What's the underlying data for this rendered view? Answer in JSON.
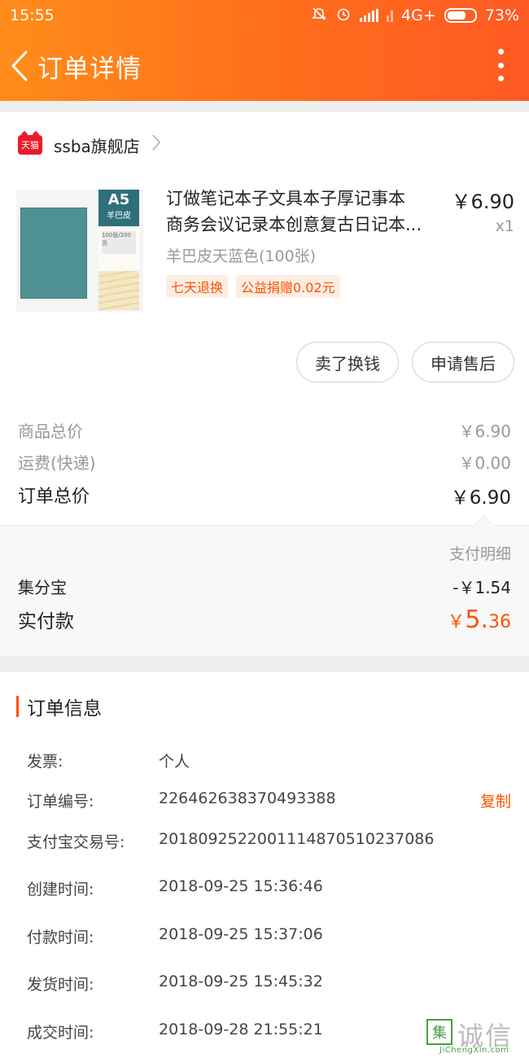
{
  "status_bar": {
    "time": "15:55",
    "network": "4G+",
    "battery": "73%",
    "battery_level": 0.73,
    "icons": [
      "mute-icon",
      "alarm-icon",
      "signal-icon",
      "signal-icon",
      "battery-icon"
    ]
  },
  "navbar": {
    "title": "订单详情",
    "back_icon": "chevron-left-icon",
    "more_icon": "more-vertical-icon"
  },
  "shop": {
    "badge": "天猫",
    "name": "ssba旗舰店"
  },
  "product": {
    "title_line1": "订做笔记本子文具本子厚记事本",
    "title_line2": "商务会议记录本创意复古日记本...",
    "price": "￥6.90",
    "quantity": "x1",
    "sku": "羊巴皮天蓝色(100张)",
    "tags": [
      "七天退换",
      "公益捐赠0.02元"
    ],
    "image": {
      "size_label": "A5",
      "cover_label": "羊巴皮",
      "pages_label": "100张/200页"
    }
  },
  "actions": {
    "sell_label": "卖了换钱",
    "after_sale_label": "申请售后"
  },
  "summary": {
    "goods_total_label": "商品总价",
    "goods_total_value": "￥6.90",
    "shipping_label": "运费(快递)",
    "shipping_value": "￥0.00",
    "order_total_label": "订单总价",
    "order_total_value": "￥6.90"
  },
  "payment": {
    "detail_label": "支付明细",
    "jifenbao_label": "集分宝",
    "jifenbao_value": "-￥1.54",
    "paid_label": "实付款",
    "paid_currency": "￥",
    "paid_integer": "5.",
    "paid_decimal": "36"
  },
  "order_info": {
    "title": "订单信息",
    "copy_label": "复制",
    "rows": [
      {
        "label": "发票:",
        "value": "个人"
      },
      {
        "label": "订单编号:",
        "value": "226462638370493388"
      },
      {
        "label": "支付宝交易号:",
        "value": "2018092522001114870510237086"
      },
      {
        "label": "创建时间:",
        "value": "2018-09-25 15:36:46"
      },
      {
        "label": "付款时间:",
        "value": "2018-09-25 15:37:06"
      },
      {
        "label": "发货时间:",
        "value": "2018-09-25 15:45:32"
      },
      {
        "label": "成交时间:",
        "value": "2018-09-28 21:55:21"
      }
    ]
  },
  "watermark": {
    "box": "集",
    "text": "诚信",
    "url": "JiChengXin.com"
  },
  "colors": {
    "header_start": "#ff8c1a",
    "header_end": "#ff5a24",
    "accent": "#ff5000"
  }
}
